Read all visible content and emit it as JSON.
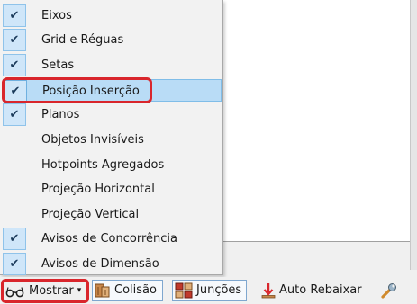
{
  "menu": {
    "items": [
      {
        "label": "Eixos",
        "checked": true,
        "highlighted": false
      },
      {
        "label": "Grid e Réguas",
        "checked": true,
        "highlighted": false
      },
      {
        "label": "Setas",
        "checked": true,
        "highlighted": false
      },
      {
        "label": "Posição Inserção",
        "checked": true,
        "highlighted": true
      },
      {
        "label": "Planos",
        "checked": true,
        "highlighted": false
      },
      {
        "label": "Objetos Invisíveis",
        "checked": false,
        "highlighted": false
      },
      {
        "label": "Hotpoints Agregados",
        "checked": false,
        "highlighted": false
      },
      {
        "label": "Projeção Horizontal",
        "checked": false,
        "highlighted": false
      },
      {
        "label": "Projeção Vertical",
        "checked": false,
        "highlighted": false
      },
      {
        "label": "Avisos de Concorrência",
        "checked": true,
        "highlighted": false
      },
      {
        "label": "Avisos de Dimensão",
        "checked": true,
        "highlighted": false
      }
    ],
    "check_glyph": "✔"
  },
  "toolbar": {
    "mostrar_label": "Mostrar",
    "mostrar_caret": "▾",
    "colisao_label": "Colisão",
    "juncoes_label": "Junções",
    "auto_rebaixar_label": "Auto Rebaixar"
  },
  "icons": {
    "mostrar": "glasses-icon",
    "colisao": "collision-icon",
    "juncoes": "junctions-icon",
    "auto_rebaixar": "down-arrow-icon",
    "tool": "wrench-icon"
  },
  "colors": {
    "highlight_outline": "#d9262c",
    "menu_highlight": "#b9dcf6",
    "check_box": "#cfe6f9"
  }
}
